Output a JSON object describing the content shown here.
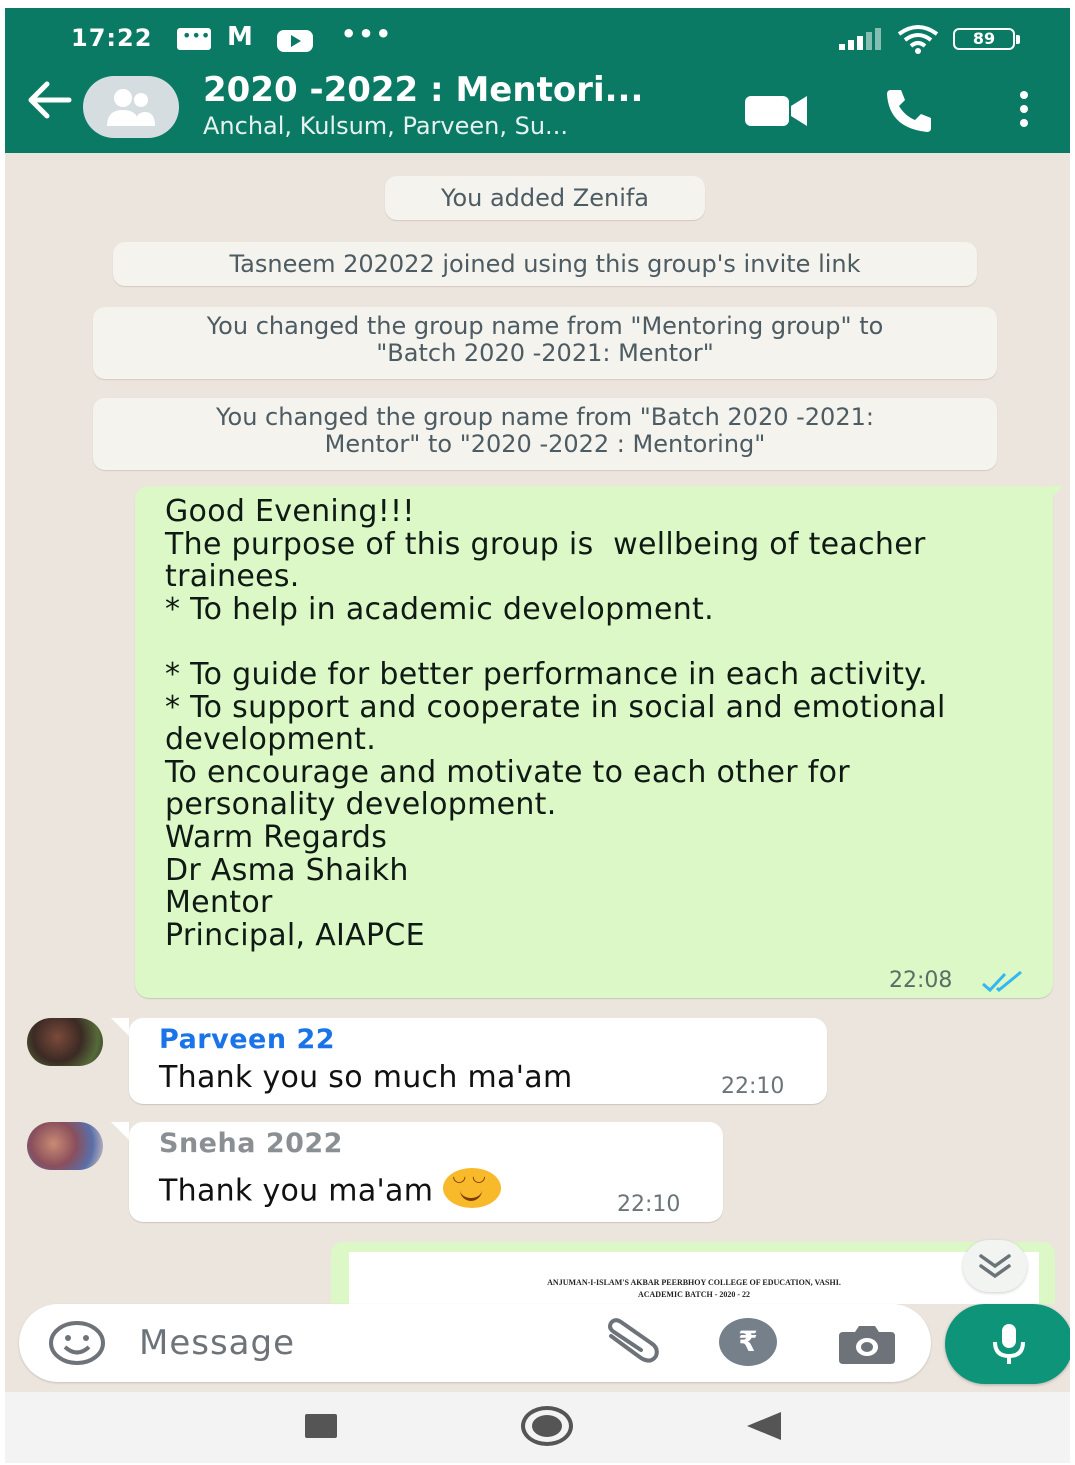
{
  "status_bar": {
    "time": "17:22",
    "more_indicator": "•••",
    "battery": "89",
    "icons": [
      "message-icon",
      "gmail-icon",
      "youtube-icon",
      "signal-icon",
      "wifi-icon",
      "battery-icon"
    ]
  },
  "header": {
    "title": "2020 -2022 : Mentori...",
    "subtitle": "Anchal, Kulsum, Parveen, Su...",
    "back_icon": "arrow-left-icon",
    "avatar_icon": "group-icon",
    "actions": [
      "video-call-icon",
      "voice-call-icon",
      "more-vert-icon"
    ]
  },
  "chat": {
    "system_messages": [
      "You added Zenifa",
      "Tasneem 202022 joined using this group's invite link",
      "You changed the group name from \"Mentoring group\" to \"Batch 2020 -2021: Mentor\"",
      "You changed the group name from \"Batch 2020 -2021: Mentor\" to \"2020 -2022 : Mentoring\""
    ],
    "outgoing": {
      "text": "Good Evening!!!\nThe purpose of this group is  wellbeing of teacher trainees.\n* To help in academic development.\n\n* To guide for better performance in each activity.\n* To support and cooperate in social and emotional development.\nTo encourage and motivate to each other for personality development.\nWarm Regards\nDr Asma Shaikh\nMentor\nPrincipal, AIAPCE",
      "time": "22:08",
      "status_icon": "double-check-read-icon"
    },
    "incoming": [
      {
        "sender": "Parveen 22",
        "sender_color": "#1a73e8",
        "text": "Thank you so much ma'am",
        "time": "22:10"
      },
      {
        "sender": "Sneha 2022",
        "sender_color": "#8a8f94",
        "text": "Thank you ma'am",
        "emoji": "smiling-face-icon",
        "time": "22:10"
      }
    ],
    "document_preview": {
      "line1": "ANJUMAN-I-ISLAM'S AKBAR PEERBHOY COLLEGE OF EDUCATION, VASHI.",
      "line2": "ACADEMIC BATCH - 2020 - 22"
    },
    "scroll_icon": "double-chevron-down-icon"
  },
  "composer": {
    "placeholder": "Message",
    "value": "",
    "pay_symbol": "₹",
    "icons": [
      "emoji-icon",
      "attach-icon",
      "payment-icon",
      "camera-icon",
      "mic-icon"
    ]
  },
  "colors": {
    "header": "#0b7a64",
    "chat_bg": "#ece5dd",
    "outgoing_bubble": "#dcf8c6",
    "incoming_bubble": "#ffffff",
    "mic_button": "#0e9478",
    "read_ticks": "#34b7f1"
  }
}
